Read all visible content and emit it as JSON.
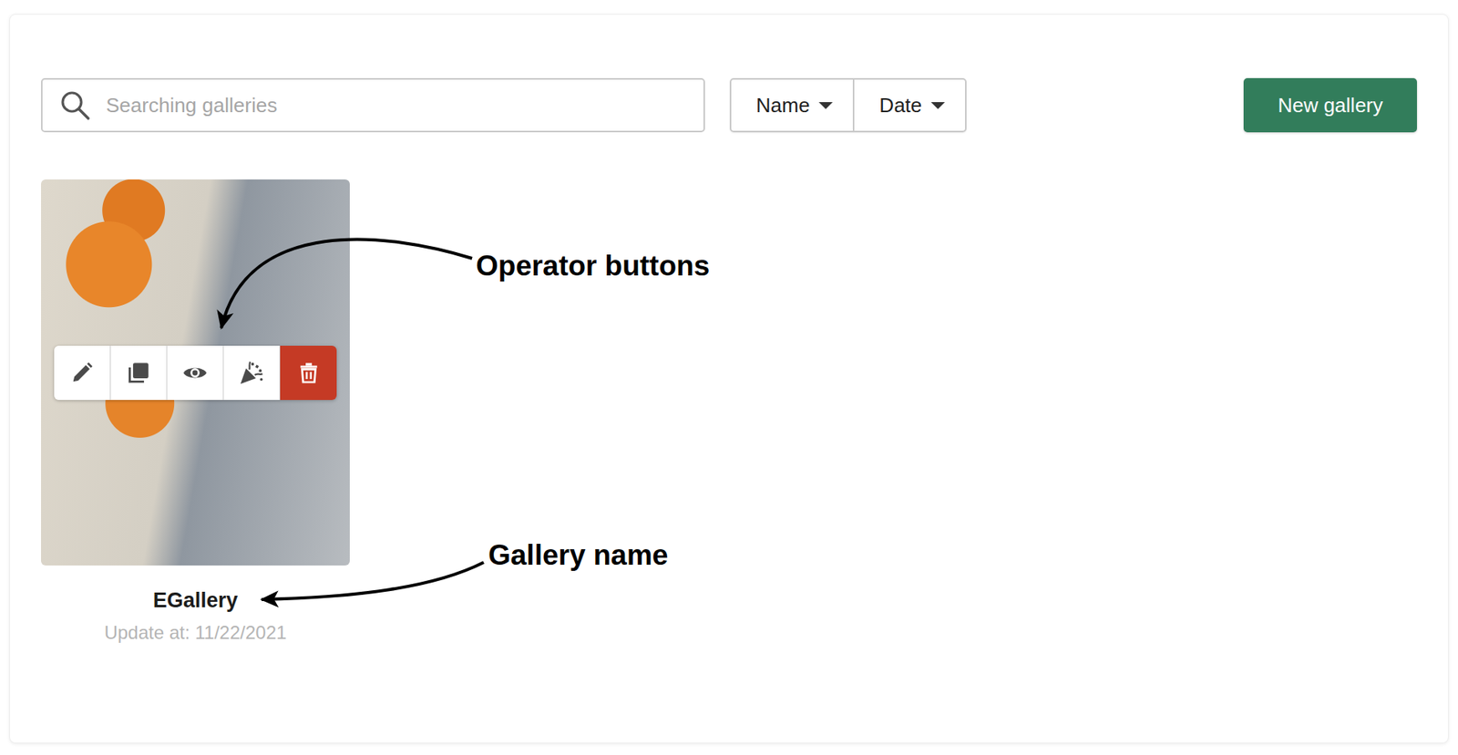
{
  "search": {
    "placeholder": "Searching galleries"
  },
  "sort_buttons": [
    {
      "label": "Name"
    },
    {
      "label": "Date"
    }
  ],
  "new_button": {
    "label": "New gallery"
  },
  "galleries": [
    {
      "name": "EGallery",
      "updated": "Update at: 11/22/2021",
      "operator_buttons": [
        {
          "kind": "edit"
        },
        {
          "kind": "duplicate"
        },
        {
          "kind": "preview"
        },
        {
          "kind": "publish"
        },
        {
          "kind": "delete"
        }
      ]
    }
  ],
  "annotations": [
    {
      "label": "Operator buttons",
      "kind": "operator"
    },
    {
      "label": "Gallery name",
      "kind": "name"
    }
  ]
}
